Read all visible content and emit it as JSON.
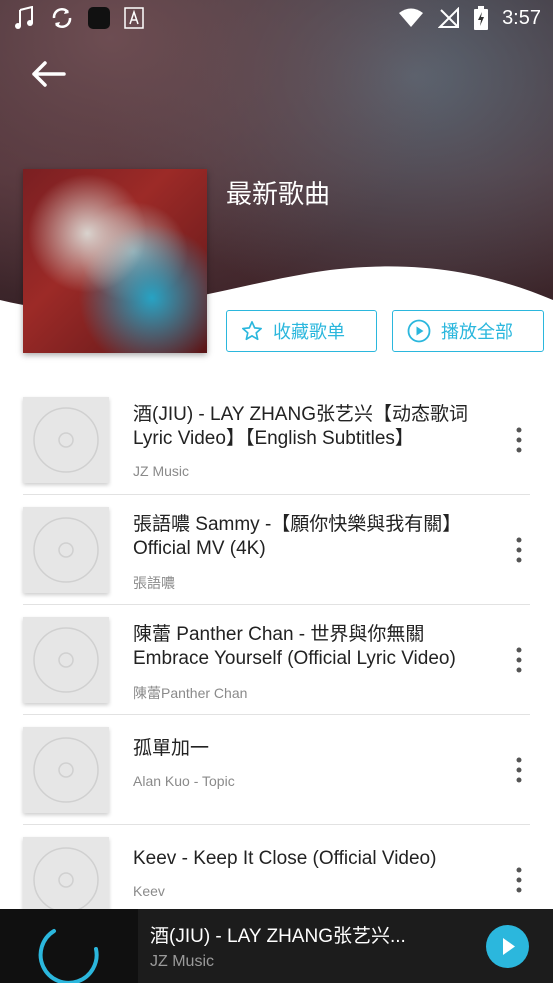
{
  "status_bar": {
    "time": "3:57"
  },
  "header": {
    "title": "最新歌曲"
  },
  "actions": {
    "favorite_label": "收藏歌单",
    "play_all_label": "播放全部"
  },
  "songs": [
    {
      "title": "酒(JIU) - LAY ZHANG张艺兴【动态歌词 Lyric Video】【English Subtitles】",
      "artist": "JZ Music"
    },
    {
      "title": "張語噥 Sammy -【願你快樂與我有關】Official MV (4K)",
      "artist": "張語噥"
    },
    {
      "title": "陳蕾 Panther Chan - 世界與你無關 Embrace Yourself (Official Lyric Video)",
      "artist": "陳蕾Panther Chan"
    },
    {
      "title": "孤單加一",
      "artist": "Alan Kuo - Topic"
    },
    {
      "title": "Keev - Keep It Close (Official Video)",
      "artist": "Keev"
    }
  ],
  "now_playing": {
    "title": "酒(JIU) - LAY ZHANG张艺兴...",
    "artist": "JZ Music"
  },
  "colors": {
    "accent": "#2bb7dd"
  }
}
